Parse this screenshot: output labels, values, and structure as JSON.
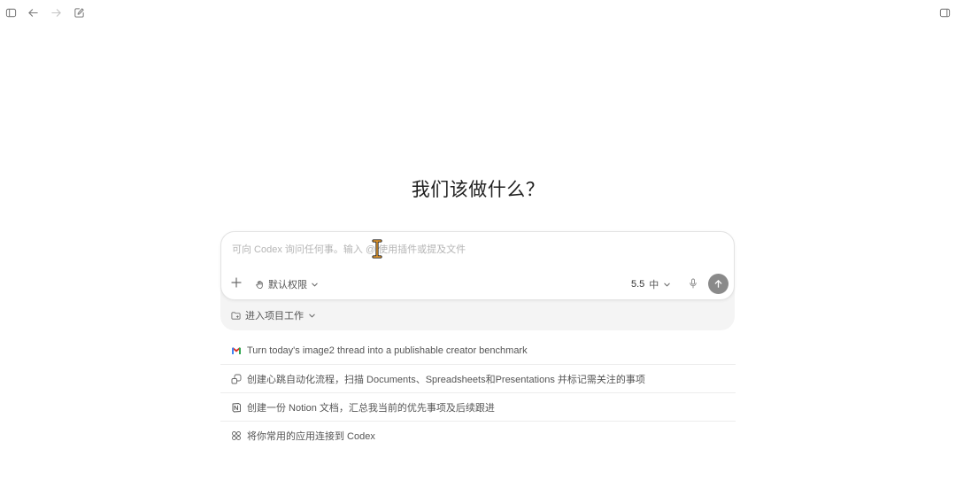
{
  "heading": "我们该做什么？",
  "composer": {
    "placeholder": "可向 Codex 询问任何事。输入 @ 使用插件或提及文件",
    "permissions_label": "默认权限",
    "model_version": "5.5",
    "reasoning_level": "中",
    "project_label": "进入项目工作"
  },
  "suggestions": [
    {
      "icon": "gmail-icon",
      "text": "Turn today's image2 thread into a publishable creator benchmark"
    },
    {
      "icon": "automation-icon",
      "text": "创建心跳自动化流程，扫描 Documents、Spreadsheets和Presentations 并标记需关注的事项"
    },
    {
      "icon": "notion-icon",
      "text": "创建一份 Notion 文档，汇总我当前的优先事项及后续跟进"
    },
    {
      "icon": "apps-grid-icon",
      "text": "将你常用的应用连接到 Codex"
    }
  ],
  "colors": {
    "send_button": "#8a8a8a",
    "gmail_red": "#d93025",
    "cursor_orange": "#f0a030"
  }
}
